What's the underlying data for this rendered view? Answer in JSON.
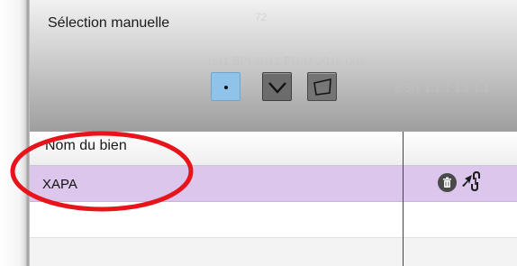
{
  "panel": {
    "title": "Sélection manuelle",
    "background_text": [
      "72",
      "1s(1 BPI 2012 PDIM 2016 001",
      "2 5(1 1 1 1 1 1 1 1"
    ]
  },
  "toolbar": {
    "buttons": [
      {
        "name": "point-select",
        "icon": "dot-icon",
        "active": true,
        "color": "#8fc3ea"
      },
      {
        "name": "line-select",
        "icon": "chevron-down-icon",
        "active": false,
        "color": "#6c6c6c"
      },
      {
        "name": "polygon-select",
        "icon": "polygon-icon",
        "active": false,
        "color": "#747474"
      }
    ]
  },
  "table": {
    "columns": [
      "Nom du bien",
      ""
    ],
    "rows": [
      {
        "name": "XAPA",
        "selected": true,
        "actions": [
          "trash-icon",
          "locate-arrow-icon",
          "link-icon"
        ]
      },
      {
        "name": "",
        "selected": false,
        "actions": []
      },
      {
        "name": "",
        "selected": false,
        "actions": []
      }
    ],
    "selected_row_color": "#dcc6ec"
  },
  "annotation": {
    "shape": "ellipse",
    "color": "#e8141c"
  }
}
